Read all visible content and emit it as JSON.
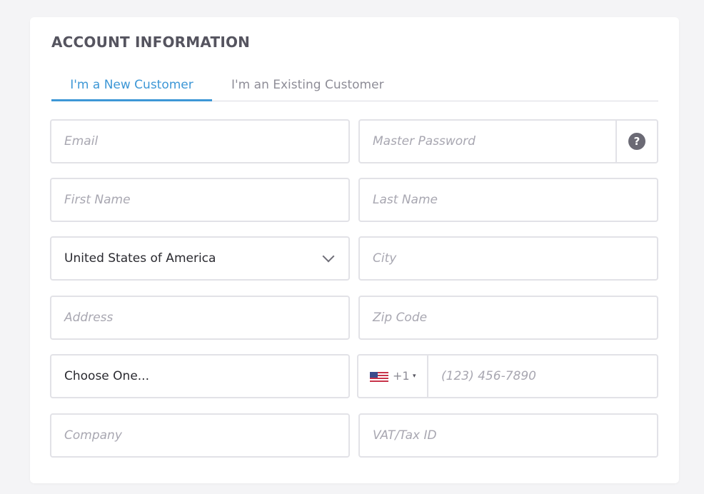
{
  "section": {
    "title": "ACCOUNT INFORMATION"
  },
  "tabs": [
    {
      "label": "I'm a New Customer",
      "active": true
    },
    {
      "label": "I'm an Existing Customer",
      "active": false
    }
  ],
  "fields": {
    "email": {
      "placeholder": "Email",
      "value": ""
    },
    "master_password": {
      "placeholder": "Master Password",
      "value": "",
      "help_icon": "question-circle-icon",
      "help_glyph": "?"
    },
    "first_name": {
      "placeholder": "First Name",
      "value": ""
    },
    "last_name": {
      "placeholder": "Last Name",
      "value": ""
    },
    "country": {
      "value": "United States of America",
      "icon": "chevron-down-icon"
    },
    "city": {
      "placeholder": "City",
      "value": ""
    },
    "address": {
      "placeholder": "Address",
      "value": ""
    },
    "zip": {
      "placeholder": "Zip Code",
      "value": ""
    },
    "select_one": {
      "value": "Choose One..."
    },
    "phone": {
      "dial_code": "+1",
      "caret": "▾",
      "flag_icon": "us-flag-icon",
      "placeholder": "(123) 456-7890",
      "value": ""
    },
    "company": {
      "placeholder": "Company",
      "value": ""
    },
    "vat": {
      "placeholder": "VAT/Tax ID",
      "value": ""
    }
  },
  "colors": {
    "accent": "#3d97d6",
    "title": "#55545f",
    "border": "#e2e2e7",
    "placeholder": "#a8a7b1"
  }
}
